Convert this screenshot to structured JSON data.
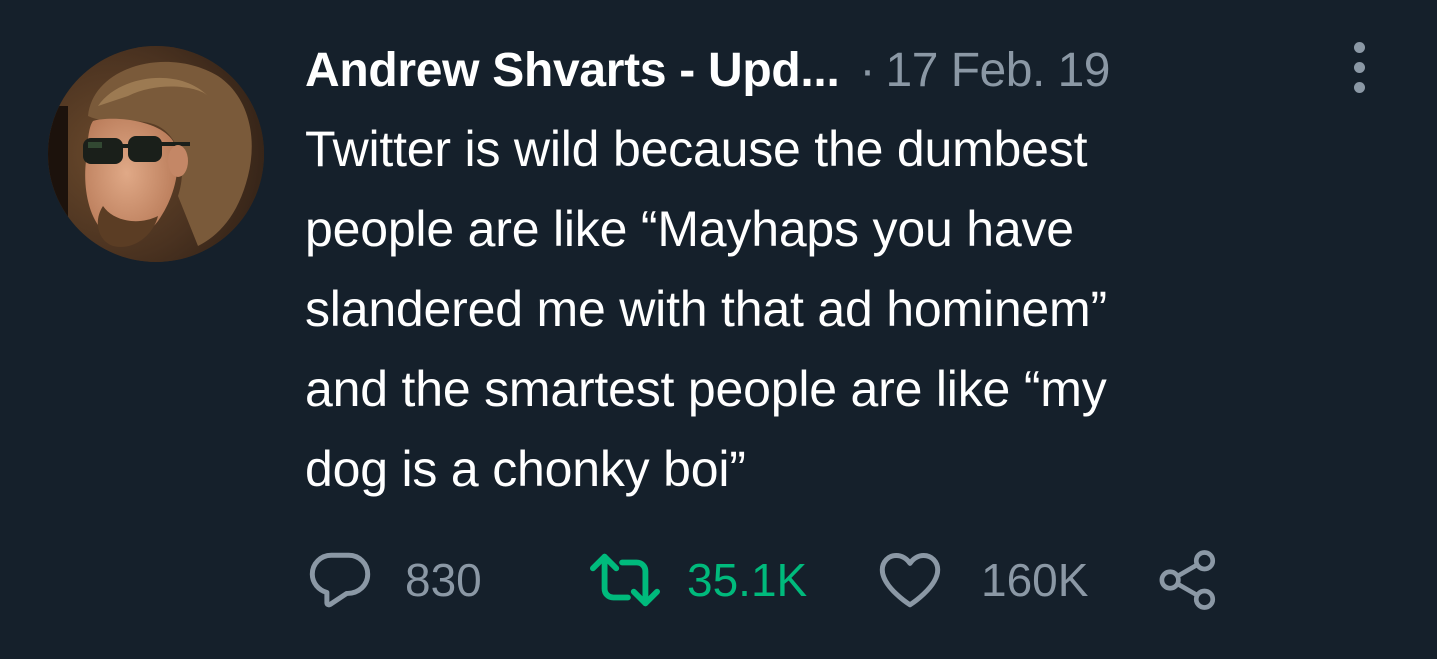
{
  "tweet": {
    "author_name": "Andrew Shvarts - Upd...",
    "separator": "·",
    "timestamp": "17 Feb. 19",
    "text_lines": [
      "Twitter is wild because the dumbest",
      "people are like “Mayhaps you have",
      "slandered me with that ad hominem”",
      "and the smartest people are like “my",
      "dog is a chonky boi”"
    ],
    "actions": {
      "replies": "830",
      "retweets": "35.1K",
      "likes": "160K"
    }
  },
  "colors": {
    "background": "#15202b",
    "text_primary": "#ffffff",
    "text_secondary": "#8b98a5",
    "retweet_active": "#00ba7c"
  },
  "icons": {
    "reply": "speech-bubble-icon",
    "retweet": "retweet-arrows-icon",
    "like": "heart-outline-icon",
    "share": "share-nodes-icon",
    "more": "vertical-ellipsis-icon"
  }
}
